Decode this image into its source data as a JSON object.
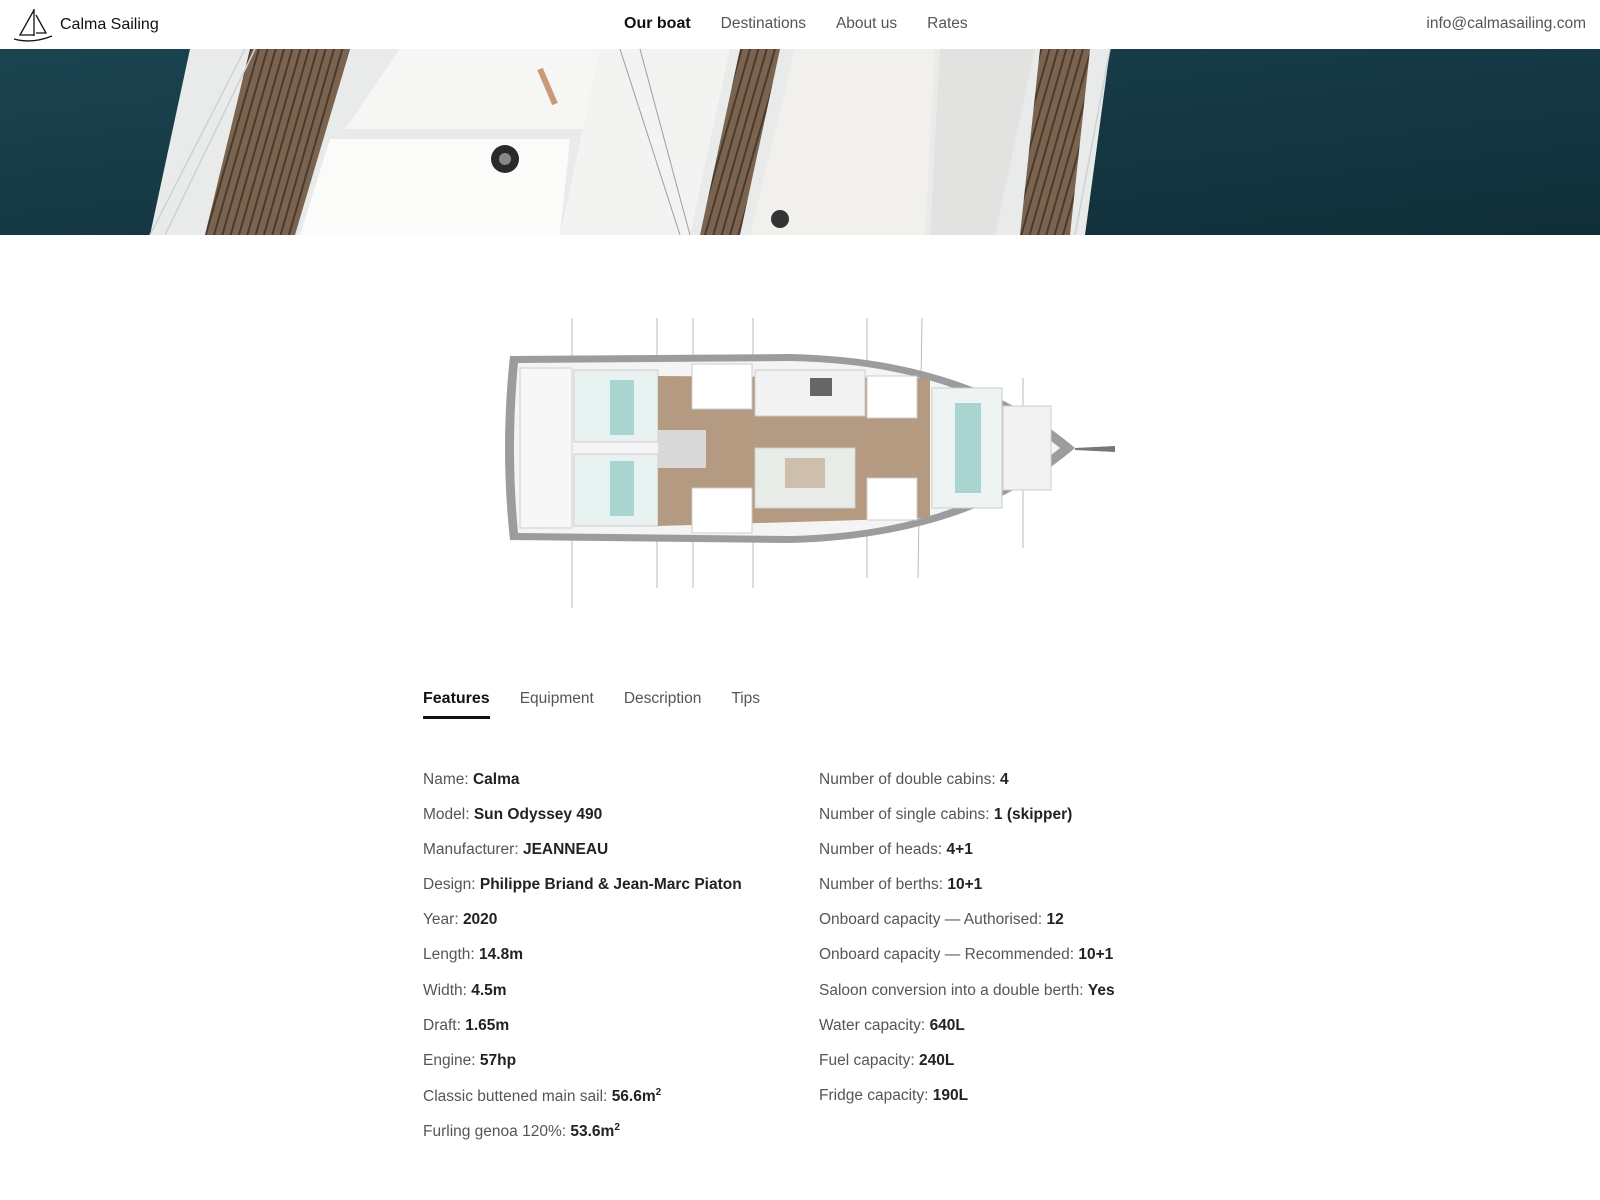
{
  "header": {
    "brand": "Calma Sailing",
    "nav": [
      "Our boat",
      "Destinations",
      "About us",
      "Rates"
    ],
    "email": "info@calmasailing.com"
  },
  "tabs": [
    "Features",
    "Equipment",
    "Description",
    "Tips"
  ],
  "specs_left": [
    {
      "label": "Name:",
      "value": "Calma"
    },
    {
      "label": "Model:",
      "value": "Sun Odyssey 490"
    },
    {
      "label": "Manufacturer:",
      "value": "JEANNEAU"
    },
    {
      "label": "Design:",
      "value": "Philippe Briand & Jean-Marc Piaton"
    },
    {
      "label": "Year:",
      "value": "2020"
    },
    {
      "label": "Length:",
      "value": "14.8m"
    },
    {
      "label": "Width:",
      "value": "4.5m"
    },
    {
      "label": "Draft:",
      "value": "1.65m"
    },
    {
      "label": "Engine:",
      "value": "57hp"
    },
    {
      "label": "Classic buttened main sail:",
      "value": "56.6m",
      "sup": "2"
    },
    {
      "label": "Furling genoa 120%:",
      "value": "53.6m",
      "sup": "2"
    }
  ],
  "specs_right": [
    {
      "label": "Number of double cabins:",
      "value": "4"
    },
    {
      "label": "Number of single cabins:",
      "value": "1 (skipper)"
    },
    {
      "label": "Number of heads:",
      "value": "4+1"
    },
    {
      "label": "Number of berths:",
      "value": "10+1"
    },
    {
      "label": "Onboard capacity — Authorised:",
      "value": "12"
    },
    {
      "label": "Onboard capacity — Recommended:",
      "value": "10+1"
    },
    {
      "label": "Saloon conversion into a double berth:",
      "value": "Yes"
    },
    {
      "label": "Water capacity:",
      "value": "640L"
    },
    {
      "label": "Fuel capacity:",
      "value": "240L"
    },
    {
      "label": "Fridge capacity:",
      "value": "190L"
    }
  ]
}
